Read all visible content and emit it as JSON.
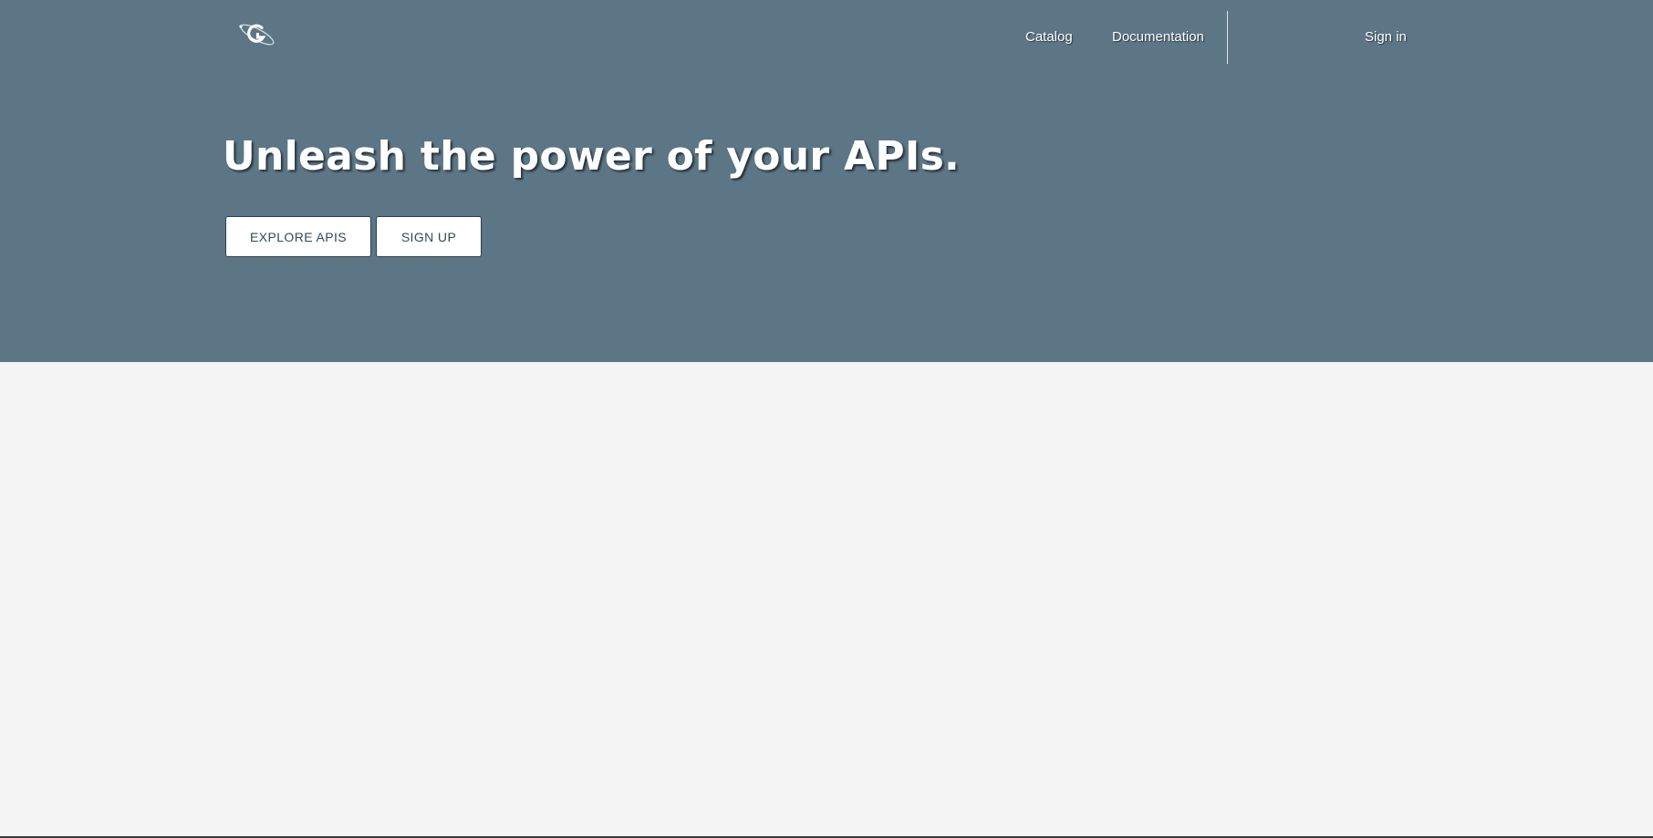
{
  "header": {
    "logo_icon": "planet-g-logo-icon",
    "nav": {
      "catalog": "Catalog",
      "documentation": "Documentation",
      "sign_in": "Sign in"
    }
  },
  "hero": {
    "headline": "Unleash the power of your APIs.",
    "buttons": {
      "explore": "EXPLORE APIS",
      "sign_up": "SIGN UP"
    }
  },
  "colors": {
    "hero_background": "#5c7686",
    "page_background": "#f4f4f4",
    "button_text": "#2f4a5a",
    "nav_text": "#ffffff"
  }
}
